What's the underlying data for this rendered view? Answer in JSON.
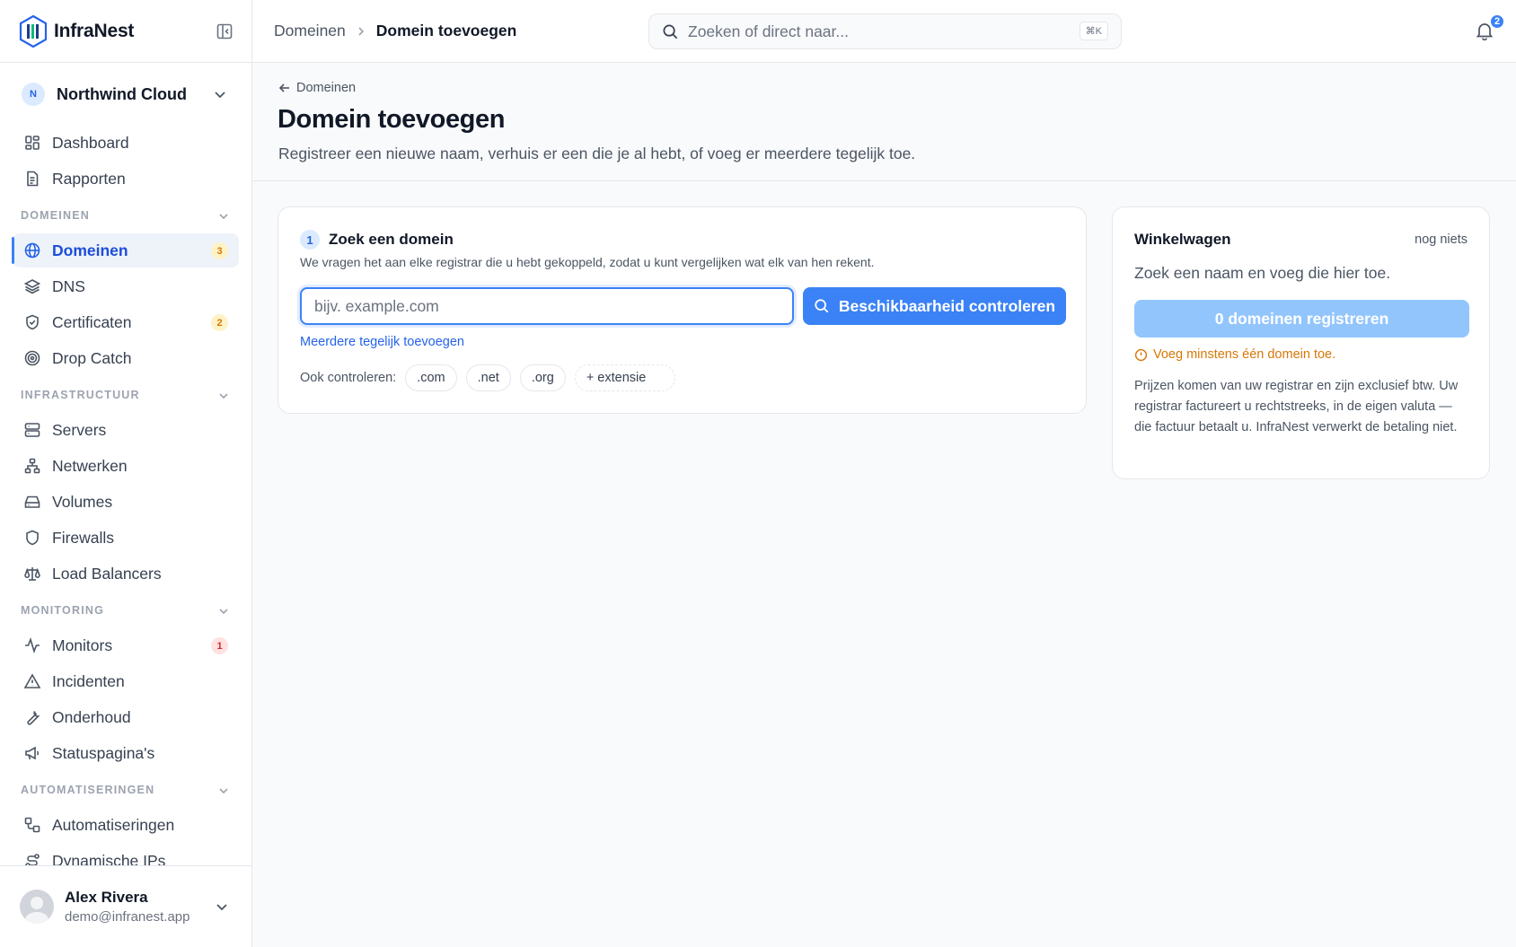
{
  "app": {
    "name": "InfraNest"
  },
  "org": {
    "initial": "N",
    "name": "Northwind Cloud"
  },
  "nav": {
    "dashboard": "Dashboard",
    "reports": "Rapporten",
    "section_domains": "DOMEINEN",
    "domains": "Domeinen",
    "domains_badge": "3",
    "dns": "DNS",
    "certificates": "Certificaten",
    "certificates_badge": "2",
    "drop_catch": "Drop Catch",
    "section_infra": "INFRASTRUCTUUR",
    "servers": "Servers",
    "networks": "Netwerken",
    "volumes": "Volumes",
    "firewalls": "Firewalls",
    "load_balancers": "Load Balancers",
    "section_monitoring": "MONITORING",
    "monitors": "Monitors",
    "monitors_badge": "1",
    "incidents": "Incidenten",
    "maintenance": "Onderhoud",
    "status_pages": "Statuspagina's",
    "section_automation": "AUTOMATISERINGEN",
    "automations": "Automatiseringen",
    "dynamic_ips": "Dynamische IPs"
  },
  "user": {
    "name": "Alex Rivera",
    "email": "demo@infranest.app"
  },
  "topbar": {
    "breadcrumb_parent": "Domeinen",
    "breadcrumb_current": "Domein toevoegen",
    "search_placeholder": "Zoeken of direct naar...",
    "search_shortcut": "⌘K",
    "notifications_count": "2"
  },
  "page": {
    "back_label": "Domeinen",
    "title": "Domein toevoegen",
    "subtitle": "Registreer een nieuwe naam, verhuis er een die je al hebt, of voeg er meerdere tegelijk toe."
  },
  "search_card": {
    "step_number": "1",
    "title": "Zoek een domein",
    "description": "We vragen het aan elke registrar die u hebt gekoppeld, zodat u kunt vergelijken wat elk van hen rekent.",
    "input_placeholder": "bijv. example.com",
    "input_value": "",
    "check_button": "Beschikbaarheid controleren",
    "multi_link": "Meerdere tegelijk toevoegen",
    "also_check_label": "Ook controleren:",
    "extensions": [
      ".com",
      ".net",
      ".org"
    ],
    "add_extension": "+ extensie"
  },
  "cart": {
    "title": "Winkelwagen",
    "status": "nog niets",
    "hint": "Zoek een naam en voeg die hier toe.",
    "register_button": "0 domeinen registreren",
    "warning": "Voeg minstens één domein toe.",
    "note": "Prijzen komen van uw registrar en zijn exclusief btw. Uw registrar factureert u rechtstreeks, in de eigen valuta — die factuur betaalt u. InfraNest verwerkt de betaling niet."
  },
  "colors": {
    "accent": "#3b82f6",
    "accent_disabled": "#93c5fd",
    "warning": "#d97706",
    "danger": "#dc2626"
  }
}
